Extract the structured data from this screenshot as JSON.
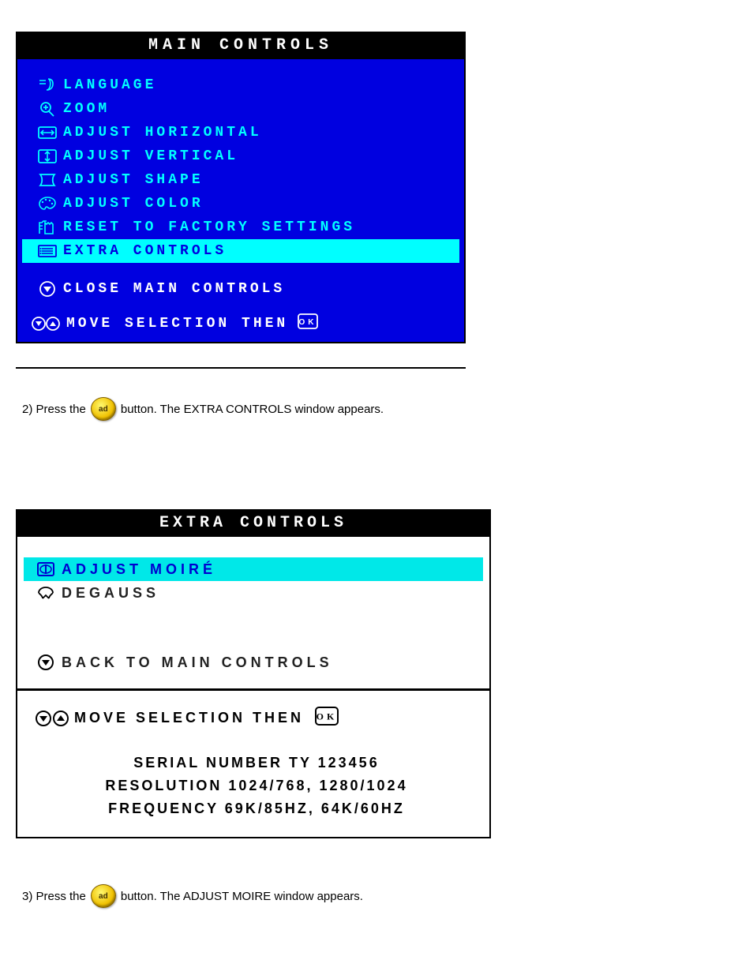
{
  "main": {
    "title": "MAIN CONTROLS",
    "items": [
      {
        "label": "LANGUAGE",
        "icon": "language-icon"
      },
      {
        "label": "ZOOM",
        "icon": "zoom-icon"
      },
      {
        "label": "ADJUST HORIZONTAL",
        "icon": "horiz-icon"
      },
      {
        "label": "ADJUST VERTICAL",
        "icon": "vert-icon"
      },
      {
        "label": "ADJUST SHAPE",
        "icon": "shape-icon"
      },
      {
        "label": "ADJUST COLOR",
        "icon": "color-icon"
      },
      {
        "label": "RESET TO FACTORY SETTINGS",
        "icon": "reset-icon"
      },
      {
        "label": "EXTRA CONTROLS",
        "icon": "extra-icon",
        "highlight": true
      }
    ],
    "close_label": "CLOSE MAIN CONTROLS",
    "footer_label": "MOVE SELECTION THEN"
  },
  "step1": {
    "prefix": "2) Press the ",
    "button": "ad",
    "suffix": " button. The EXTRA CONTROLS window appears."
  },
  "extra": {
    "title": "EXTRA CONTROLS",
    "items": [
      {
        "label": "ADJUST MOIRÉ",
        "icon": "moire-icon",
        "highlight": true
      },
      {
        "label": "DEGAUSS",
        "icon": "degauss-icon"
      }
    ],
    "back_label": "BACK TO MAIN CONTROLS",
    "footer_label": "MOVE SELECTION THEN",
    "serial_label": "SERIAL NUMBER TY 123456",
    "resolution_label": "RESOLUTION 1024/768, 1280/1024",
    "frequency_label": "FREQUENCY 69K/85HZ, 64K/60HZ"
  },
  "step2": {
    "prefix": "3) Press the ",
    "button": "ad",
    "suffix": " button. The ADJUST MOIRE window appears."
  }
}
